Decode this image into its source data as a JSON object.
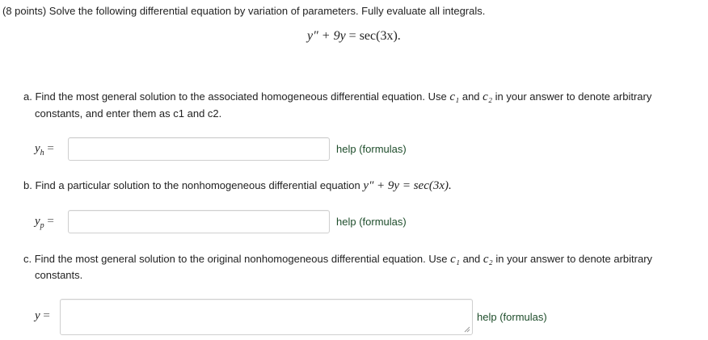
{
  "problem": {
    "intro": "(8 points) Solve the following differential equation by variation of parameters. Fully evaluate all integrals.",
    "equation_lhs": "y″ + 9y",
    "equation_rhs": "sec(3x)."
  },
  "part_a": {
    "text_line1": "a. Find the most general solution to the associated homogeneous differential equation. Use",
    "c1": "c₁",
    "and": "and",
    "c2": "c₂",
    "text_line1_end": "in your answer to denote arbitrary",
    "text_line2": "constants, and enter them as c1 and c2.",
    "var_base": "y",
    "var_sub": "h",
    "help": "help (formulas)"
  },
  "part_b": {
    "text": "b. Find a particular solution to the nonhomogeneous differential equation",
    "equation": "y″ + 9y = sec(3x).",
    "var_base": "y",
    "var_sub": "p",
    "help": "help (formulas)"
  },
  "part_c": {
    "text_line1": "c. Find the most general solution to the original nonhomogeneous differential equation. Use",
    "c1": "c₁",
    "and": "and",
    "c2": "c₂",
    "text_line1_end": "in your answer to denote arbitrary",
    "text_line2": "constants.",
    "var_base": "y",
    "help": "help (formulas)"
  },
  "equals": "="
}
